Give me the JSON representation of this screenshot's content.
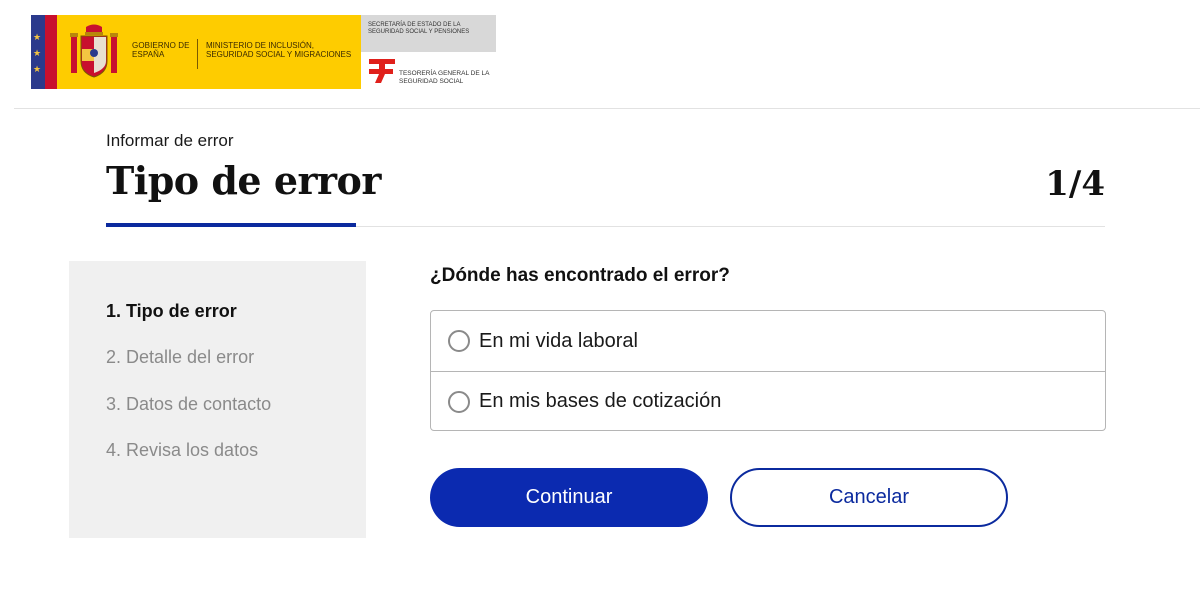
{
  "header": {
    "gobierno": "GOBIERNO DE ESPAÑA",
    "ministerio": "MINISTERIO DE INCLUSIÓN, SEGURIDAD SOCIAL Y MIGRACIONES",
    "secretaria": "SECRETARÍA DE ESTADO DE LA SEGURIDAD SOCIAL Y PENSIONES",
    "tesoreria": "TESORERÍA GENERAL DE LA SEGURIDAD SOCIAL",
    "colors": {
      "flag_blue": "#2b3a8c",
      "flag_red": "#c8102e",
      "gov_yellow": "#fecc00",
      "grey": "#d8d8d8"
    }
  },
  "title_area": {
    "breadcrumb": "Informar de error",
    "title": "Tipo de error",
    "step_counter": "1/4",
    "accent_color": "#0b2a9e"
  },
  "steps": [
    {
      "label": "1.  Tipo de error",
      "state": "active"
    },
    {
      "label": "2.  Detalle del error",
      "state": "pending"
    },
    {
      "label": "3.  Datos de contacto",
      "state": "pending"
    },
    {
      "label": "4.  Revisa los datos",
      "state": "pending"
    }
  ],
  "form": {
    "question": "¿Dónde has encontrado el error?",
    "options": [
      {
        "label": "En mi vida laboral",
        "selected": false
      },
      {
        "label": "En mis bases de cotización",
        "selected": false
      }
    ]
  },
  "actions": {
    "continue_label": "Continuar",
    "cancel_label": "Cancelar"
  }
}
